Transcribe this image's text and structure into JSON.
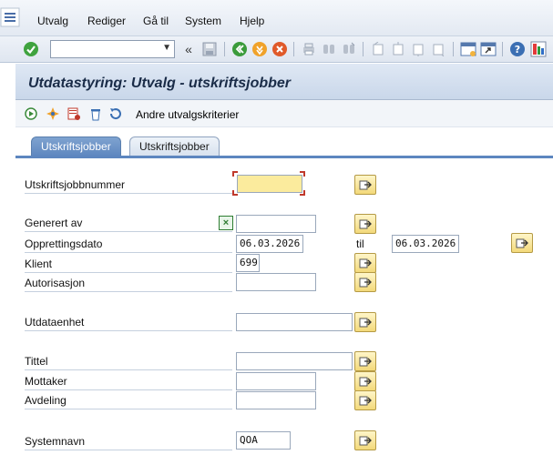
{
  "menu": {
    "items": [
      {
        "label": "Utvalg"
      },
      {
        "label": "Rediger"
      },
      {
        "label": "Gå til"
      },
      {
        "label": "System"
      },
      {
        "label": "Hjelp"
      }
    ]
  },
  "toolbar": {
    "command_value": "",
    "icons": [
      "enter-icon",
      "back-icon",
      "save-icon",
      "back-green-icon",
      "exit-icon",
      "cancel-icon",
      "print-icon",
      "find-icon",
      "find-next-icon",
      "first-page-icon",
      "prev-page-icon",
      "next-page-icon",
      "last-page-icon",
      "new-session-icon",
      "shortcut-icon",
      "help-icon",
      "customize-layout-icon"
    ]
  },
  "title": "Utdatastyring: Utvalg - utskriftsjobber",
  "app_toolbar": {
    "other_criteria_label": "Andre utvalgskriterier"
  },
  "tabs": [
    {
      "label": "Utskriftsjobber",
      "active": true
    },
    {
      "label": "Utskriftsjobber",
      "active": false
    }
  ],
  "form": {
    "spool_number": {
      "label": "Utskriftsjobbnummer",
      "value": ""
    },
    "created_by": {
      "label": "Generert av",
      "value": ""
    },
    "created_on": {
      "label": "Opprettingsdato",
      "from": "06.03.2026",
      "to_label": "til",
      "to": "06.03.2026"
    },
    "client": {
      "label": "Klient",
      "value": "699"
    },
    "authorization": {
      "label": "Autorisasjon",
      "value": ""
    },
    "output_device": {
      "label": "Utdataenhet",
      "value": ""
    },
    "title": {
      "label": "Tittel",
      "value": ""
    },
    "recipient": {
      "label": "Mottaker",
      "value": ""
    },
    "department": {
      "label": "Avdeling",
      "value": ""
    },
    "system_name": {
      "label": "Systemnavn",
      "value": "QOA"
    }
  },
  "colors": {
    "title_text": "#1a2c48",
    "tab_active": "#5d86bf",
    "focus_field": "#fbeb9d",
    "multisel_button": "#f3d97a"
  }
}
